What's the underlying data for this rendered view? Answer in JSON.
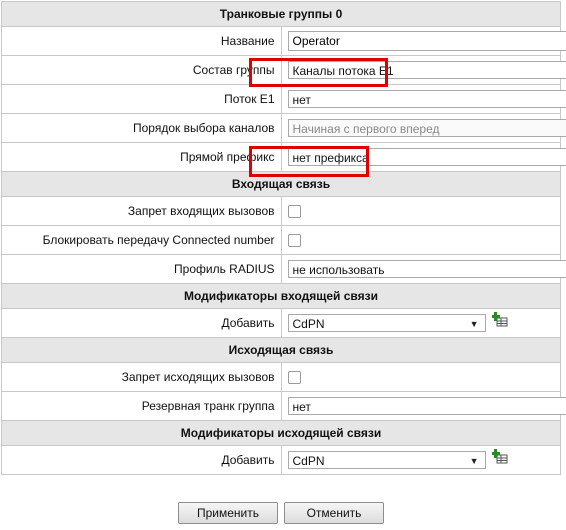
{
  "sections": {
    "trunk_groups_title": "Транковые группы 0",
    "incoming_title": "Входящая связь",
    "incoming_mods_title": "Модификаторы входящей связи",
    "outgoing_title": "Исходящая связь",
    "outgoing_mods_title": "Модификаторы исходящей связи"
  },
  "fields": {
    "name_label": "Название",
    "name_value": "Operator",
    "composition_label": "Состав группы",
    "composition_value": "Каналы потока E1",
    "stream_label": "Поток E1",
    "stream_value": "нет",
    "order_label": "Порядок выбора каналов",
    "order_value": "Начиная с первого вперед",
    "prefix_label": "Прямой префикс",
    "prefix_value": "нет префикса",
    "deny_incoming_label": "Запрет входящих вызовов",
    "block_connected_label": "Блокировать передачу Connected number",
    "radius_label": "Профиль RADIUS",
    "radius_value": "не использовать",
    "add_in_label": "Добавить",
    "add_in_value": "CdPN",
    "deny_outgoing_label": "Запрет исходящих вызовов",
    "reserve_label": "Резервная транк группа",
    "reserve_value": "нет",
    "add_out_label": "Добавить",
    "add_out_value": "CdPN"
  },
  "buttons": {
    "apply": "Применить",
    "cancel": "Отменить"
  },
  "icons": {
    "dropdown": "chevron-down-icon",
    "add": "add-table-icon"
  },
  "colors": {
    "highlight": "#e00000",
    "header_bg": "#e6e6e6",
    "border": "#c8c8c8"
  }
}
